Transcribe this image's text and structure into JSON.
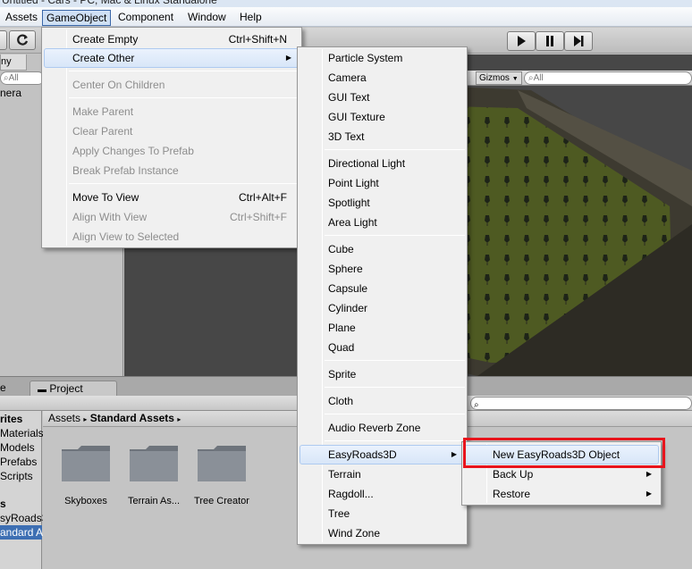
{
  "window": {
    "title": "Untitled - Cars - PC, Mac & Linux Standalone"
  },
  "menubar": {
    "items": [
      {
        "label": "Assets"
      },
      {
        "label": "GameObject"
      },
      {
        "label": "Component"
      },
      {
        "label": "Window"
      },
      {
        "label": "Help"
      }
    ]
  },
  "toolbar": {
    "refresh_icon": "refresh-icon",
    "play_icon": "play-icon",
    "pause_icon": "pause-icon",
    "step_icon": "step-icon"
  },
  "hierarchy": {
    "tab": "ny",
    "search_placeholder": "All",
    "items": [
      "nera"
    ]
  },
  "scene": {
    "gizmos_label": "Gizmos",
    "search_placeholder": "All"
  },
  "project": {
    "left_tab": "e",
    "tab_label": "Project",
    "tree": [
      "rites",
      "Materials",
      "Models",
      "Prefabs",
      "Scripts",
      "s",
      "syRoads3",
      "andard As"
    ],
    "breadcrumb": {
      "root": "Assets",
      "current": "Standard Assets"
    },
    "folders": [
      "Skyboxes",
      "Terrain As...",
      "Tree Creator"
    ]
  },
  "gameobject_menu": {
    "items": [
      {
        "label": "Create Empty",
        "shortcut": "Ctrl+Shift+N"
      },
      {
        "label": "Create Other"
      },
      {
        "label": "Center On Children"
      },
      {
        "label": "Make Parent"
      },
      {
        "label": "Clear Parent"
      },
      {
        "label": "Apply Changes To Prefab"
      },
      {
        "label": "Break Prefab Instance"
      },
      {
        "label": "Move To View",
        "shortcut": "Ctrl+Alt+F"
      },
      {
        "label": "Align With View",
        "shortcut": "Ctrl+Shift+F"
      },
      {
        "label": "Align View to Selected"
      }
    ]
  },
  "create_other_menu": {
    "items": [
      {
        "label": "Particle System"
      },
      {
        "label": "Camera"
      },
      {
        "label": "GUI Text"
      },
      {
        "label": "GUI Texture"
      },
      {
        "label": "3D Text"
      },
      {
        "label": "Directional Light"
      },
      {
        "label": "Point Light"
      },
      {
        "label": "Spotlight"
      },
      {
        "label": "Area Light"
      },
      {
        "label": "Cube"
      },
      {
        "label": "Sphere"
      },
      {
        "label": "Capsule"
      },
      {
        "label": "Cylinder"
      },
      {
        "label": "Plane"
      },
      {
        "label": "Quad"
      },
      {
        "label": "Sprite"
      },
      {
        "label": "Cloth"
      },
      {
        "label": "Audio Reverb Zone"
      },
      {
        "label": "EasyRoads3D"
      },
      {
        "label": "Terrain"
      },
      {
        "label": "Ragdoll..."
      },
      {
        "label": "Tree"
      },
      {
        "label": "Wind Zone"
      }
    ]
  },
  "easyroads_menu": {
    "items": [
      {
        "label": "New EasyRoads3D Object"
      },
      {
        "label": "Back Up"
      },
      {
        "label": "Restore"
      }
    ]
  },
  "colors": {
    "highlight_box": "#e8141c",
    "selection": "#3d6fb3"
  }
}
